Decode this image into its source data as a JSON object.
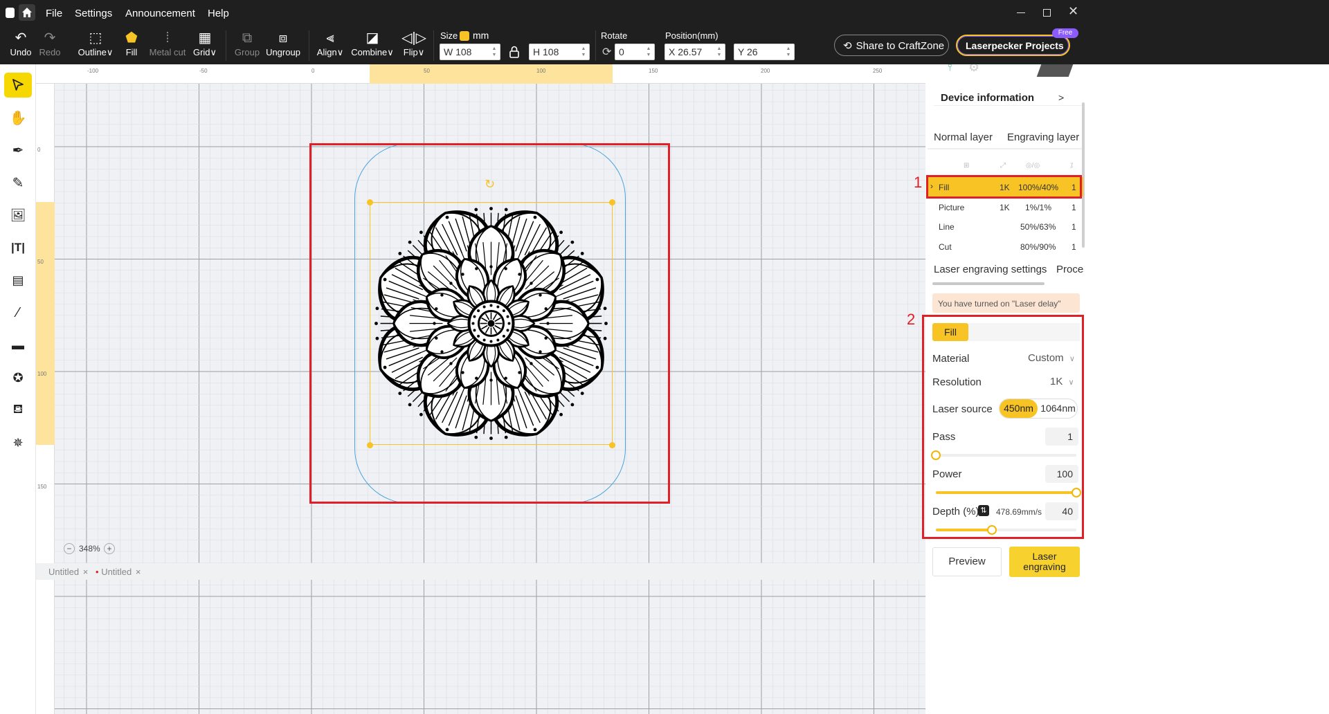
{
  "menubar": {
    "items": [
      "File",
      "Settings",
      "Announcement",
      "Help"
    ]
  },
  "toolbar": {
    "undo": "Undo",
    "redo": "Redo",
    "outline": "Outline",
    "fill": "Fill",
    "metal_cut": "Metal cut",
    "grid": "Grid",
    "group": "Group",
    "ungroup": "Ungroup",
    "align": "Align",
    "combine": "Combine",
    "flip": "Flip",
    "size_label": "Size",
    "size_unit": "mm",
    "width": "W 108",
    "height": "H 108",
    "rotate_label": "Rotate",
    "rotate_value": "0",
    "position_label": "Position(mm)",
    "x": "X 26.57",
    "y": "Y 26",
    "share": "Share to CraftZone",
    "projects": "Laserpecker Projects",
    "free_badge": "Free"
  },
  "ruler": {
    "top": [
      "-100",
      "-50",
      "0",
      "50",
      "100",
      "150",
      "200",
      "250"
    ],
    "left": [
      "0",
      "50",
      "100",
      "150"
    ]
  },
  "zoom": "348%",
  "tabs": [
    {
      "label": "Untitled",
      "modified": false
    },
    {
      "label": "Untitled",
      "modified": true
    }
  ],
  "device": {
    "label": "Device information",
    "chevron": ">"
  },
  "layers": {
    "tabs": [
      "Normal layer",
      "Engraving layer"
    ],
    "rows": [
      {
        "name": "Fill",
        "res": "1K",
        "power": "100%/40%",
        "pass": "1",
        "selected": true
      },
      {
        "name": "Picture",
        "res": "1K",
        "power": "1%/1%",
        "pass": "1",
        "selected": false
      },
      {
        "name": "Line",
        "res": "",
        "power": "50%/63%",
        "pass": "1",
        "selected": false
      },
      {
        "name": "Cut",
        "res": "",
        "power": "80%/90%",
        "pass": "1",
        "selected": false
      }
    ]
  },
  "settings": {
    "tabs": [
      "Laser engraving settings",
      "Proces"
    ],
    "notice": "You have turned on \"Laser delay\"",
    "chip": "Fill",
    "material_label": "Material",
    "material_value": "Custom",
    "resolution_label": "Resolution",
    "resolution_value": "1K",
    "laser_label": "Laser source",
    "laser_options": [
      "450nm",
      "1064nm"
    ],
    "laser_selected": "450nm",
    "pass_label": "Pass",
    "pass_value": "1",
    "pass_fraction": 0,
    "power_label": "Power",
    "power_value": "100",
    "power_fraction": 1.0,
    "depth_label": "Depth (%)",
    "depth_speed": "478.69mm/s",
    "depth_value": "40",
    "depth_fraction": 0.4
  },
  "actions": {
    "preview": "Preview",
    "engrave_line1": "Laser",
    "engrave_line2": "engraving"
  },
  "annotations": [
    "1",
    "2"
  ],
  "colors": {
    "accent": "#f7c325",
    "annotation": "#e01f26",
    "bounds": "#4aa3df"
  }
}
